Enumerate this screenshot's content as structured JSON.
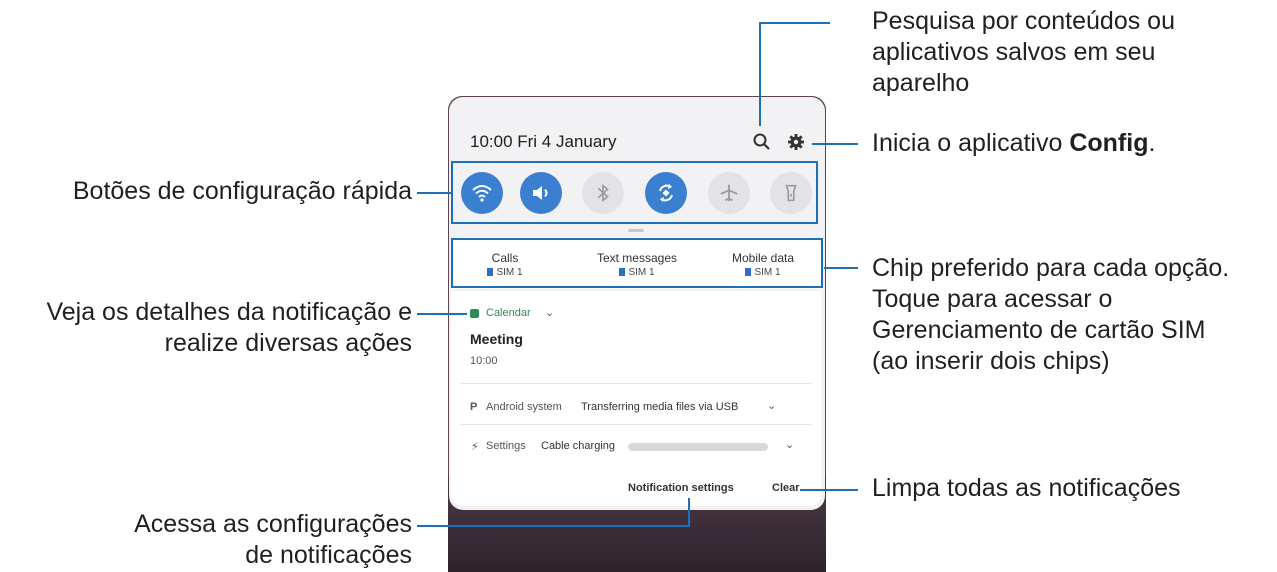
{
  "annotations": {
    "search": [
      "Pesquisa por conteúdos ou",
      "aplicativos salvos em seu",
      "aparelho"
    ],
    "settings_prefix": "Inicia o aplicativo ",
    "settings_bold": "Config",
    "settings_suffix": ".",
    "quick_settings": "Botões de configuração rápida",
    "sim": [
      "Chip preferido para cada opção.",
      "Toque para acessar o",
      "Gerenciamento de cartão SIM",
      "(ao inserir dois chips)"
    ],
    "notification": [
      "Veja os detalhes da notificação e",
      "realize diversas ações"
    ],
    "clear": "Limpa todas as notificações",
    "notif_settings": [
      "Acessa as configurações",
      "de notificações"
    ]
  },
  "phone": {
    "status": "10:00  Fri 4 January",
    "icons": [
      "search-icon",
      "gear-icon"
    ],
    "quick_buttons": [
      {
        "icon": "wifi-icon",
        "on": true
      },
      {
        "icon": "sound-icon",
        "on": true
      },
      {
        "icon": "bluetooth-icon",
        "on": false
      },
      {
        "icon": "autorotate-icon",
        "on": true
      },
      {
        "icon": "airplane-icon",
        "on": false
      },
      {
        "icon": "flashlight-icon",
        "on": false
      }
    ],
    "sim": [
      {
        "label": "Calls",
        "sim": "SIM 1"
      },
      {
        "label": "Text messages",
        "sim": "SIM 1"
      },
      {
        "label": "Mobile data",
        "sim": "SIM 1"
      }
    ],
    "calendar": {
      "app": "Calendar",
      "title": "Meeting",
      "time": "10:00"
    },
    "android": {
      "app": "Android system",
      "text": "Transferring media files via USB"
    },
    "charging": {
      "app": "Settings",
      "text": "Cable charging"
    },
    "footer": {
      "settings": "Notification settings",
      "clear": "Clear"
    }
  },
  "colors": {
    "accent": "#1d6fb8",
    "toggle_on": "#3b7fd0"
  }
}
